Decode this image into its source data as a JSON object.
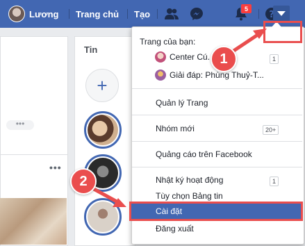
{
  "topbar": {
    "user_name": "Lương",
    "home_label": "Trang chủ",
    "create_label": "Tạo",
    "notifications_count": "5"
  },
  "background": {
    "stories_title": "Tin"
  },
  "menu": {
    "pages_header": "Trang của bạn:",
    "pages": [
      {
        "name": "Center Cú...",
        "count": "1"
      },
      {
        "name": "Giải đáp: Phùng Thuỷ-T...",
        "count": ""
      }
    ],
    "items": [
      {
        "label": "Quản lý Trang",
        "count": ""
      },
      {
        "label": "Nhóm mới",
        "count": "20+"
      },
      {
        "label": "Quảng cáo trên Facebook",
        "count": ""
      },
      {
        "label": "Nhật ký hoạt động",
        "count": "1"
      },
      {
        "label": "Tùy chọn Bảng tin",
        "count": ""
      },
      {
        "label": "Cài đặt",
        "count": ""
      },
      {
        "label": "Đăng xuất",
        "count": ""
      }
    ]
  },
  "annotations": {
    "step1": "1",
    "step2": "2",
    "color": "#e94e4e"
  },
  "colors": {
    "brand": "#4267b2",
    "highlight": "#4267b2",
    "badge": "#fa3e3e"
  }
}
